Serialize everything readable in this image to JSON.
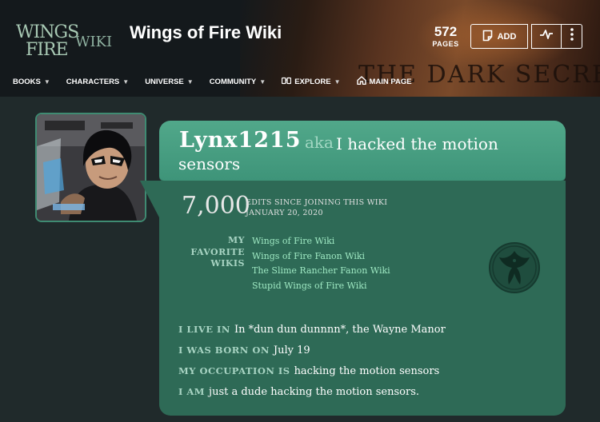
{
  "header": {
    "logo_line1": "WINGS",
    "logo_line2": "FIRE",
    "logo_wiki": "WIKI",
    "site_title": "Wings of Fire Wiki",
    "pages_count": "572",
    "pages_label": "PAGES",
    "add_label": "ADD",
    "banner_text": "THE DARK SECRET"
  },
  "nav": {
    "items": [
      {
        "label": "BOOKS"
      },
      {
        "label": "CHARACTERS"
      },
      {
        "label": "UNIVERSE"
      },
      {
        "label": "COMMUNITY"
      },
      {
        "label": "EXPLORE"
      },
      {
        "label": "MAIN PAGE"
      }
    ]
  },
  "profile": {
    "username": "Lynx1215",
    "aka": "aka",
    "nickname_line1": "I hacked the motion",
    "nickname_line2": "sensors",
    "edit_count": "7,000",
    "edits_line1": "EDITS SINCE JOINING THIS WIKI",
    "edits_line2": "JANUARY 20, 2020",
    "fav_label_1": "MY",
    "fav_label_2": "FAVORITE",
    "fav_label_3": "WIKIS",
    "favorite_wikis": [
      "Wings of Fire Wiki",
      "Wings of Fire Fanon Wiki",
      "The Slime Rancher Fanon Wiki",
      "Stupid Wings of Fire Wiki"
    ],
    "facts": [
      {
        "key": "I LIVE IN",
        "value": "In *dun dun dunnnn*, the Wayne Manor"
      },
      {
        "key": "I WAS BORN ON",
        "value": "July 19"
      },
      {
        "key": "MY OCCUPATION IS",
        "value": "hacking the motion sensors"
      },
      {
        "key": "I AM",
        "value": "just a dude hacking the motion sensors."
      }
    ]
  },
  "colors": {
    "card_header": "#4aa284",
    "card_body": "#2e6a56",
    "link": "#9ee8c2",
    "label": "#a8d4c3",
    "page_bg": "#202a2b"
  }
}
